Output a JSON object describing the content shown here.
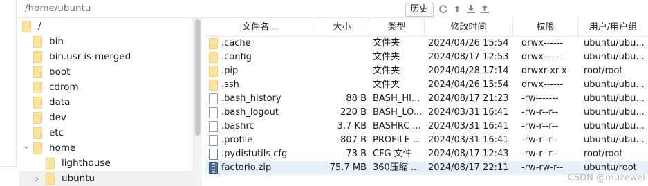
{
  "path": {
    "current": "/home/ubuntu",
    "history_label": "历史"
  },
  "toolbar_icons": [
    "refresh-icon",
    "upload-icon",
    "download-icon",
    "upload-to-icon"
  ],
  "tree": [
    {
      "label": "/",
      "depth": 0,
      "arrow": ""
    },
    {
      "label": "bin",
      "depth": 1,
      "arrow": ""
    },
    {
      "label": "bin.usr-is-merged",
      "depth": 1,
      "arrow": ""
    },
    {
      "label": "boot",
      "depth": 1,
      "arrow": ""
    },
    {
      "label": "cdrom",
      "depth": 1,
      "arrow": ""
    },
    {
      "label": "data",
      "depth": 1,
      "arrow": ""
    },
    {
      "label": "dev",
      "depth": 1,
      "arrow": ""
    },
    {
      "label": "etc",
      "depth": 1,
      "arrow": ""
    },
    {
      "label": "home",
      "depth": 1,
      "arrow": "expanded"
    },
    {
      "label": "lighthouse",
      "depth": 2,
      "arrow": ""
    },
    {
      "label": "ubuntu",
      "depth": 2,
      "arrow": "collapsed"
    }
  ],
  "columns": [
    "文件名",
    "大小",
    "类型",
    "修改时间",
    "权限",
    "用户/用户组"
  ],
  "files": [
    {
      "name": ".cache",
      "size": "",
      "type": "文件夹",
      "modified": "2024/04/26 15:54",
      "perm": "drwx------",
      "owner": "ubuntu/ubu...",
      "icon": "folder"
    },
    {
      "name": ".config",
      "size": "",
      "type": "文件夹",
      "modified": "2024/08/17 12:53",
      "perm": "drwx------",
      "owner": "ubuntu/ubu...",
      "icon": "folder"
    },
    {
      "name": ".pip",
      "size": "",
      "type": "文件夹",
      "modified": "2024/04/28 17:14",
      "perm": "drwxr-xr-x",
      "owner": "root/root",
      "icon": "folder"
    },
    {
      "name": ".ssh",
      "size": "",
      "type": "文件夹",
      "modified": "2024/04/26 15:54",
      "perm": "drwx------",
      "owner": "ubuntu/ubu...",
      "icon": "folder"
    },
    {
      "name": ".bash_history",
      "size": "88 B",
      "type": "BASH_HI...",
      "modified": "2024/08/17 21:23",
      "perm": "-rw-------",
      "owner": "ubuntu/ubu...",
      "icon": "file"
    },
    {
      "name": ".bash_logout",
      "size": "220 B",
      "type": "BASH_LO...",
      "modified": "2024/03/31 16:41",
      "perm": "-rw-r--r--",
      "owner": "ubuntu/ubu...",
      "icon": "file"
    },
    {
      "name": ".bashrc",
      "size": "3.7 KB",
      "type": "BASHRC ...",
      "modified": "2024/03/31 16:41",
      "perm": "-rw-r--r--",
      "owner": "ubuntu/ubu...",
      "icon": "file"
    },
    {
      "name": ".profile",
      "size": "807 B",
      "type": "PROFILE ...",
      "modified": "2024/03/31 16:41",
      "perm": "-rw-r--r--",
      "owner": "ubuntu/ubu...",
      "icon": "file"
    },
    {
      "name": ".pydistutils.cfg",
      "size": "73 B",
      "type": "CFG 文件",
      "modified": "2024/08/17 12:43",
      "perm": "-rw-r--r--",
      "owner": "root/root",
      "icon": "cfg"
    },
    {
      "name": "factorio.zip",
      "size": "75.7 MB",
      "type": "360压缩 ...",
      "modified": "2024/08/17 22:11",
      "perm": "-rw-rw-r--",
      "owner": "ubuntu/root",
      "icon": "zip",
      "selected": true
    }
  ],
  "watermark": "CSDN @muzewei"
}
